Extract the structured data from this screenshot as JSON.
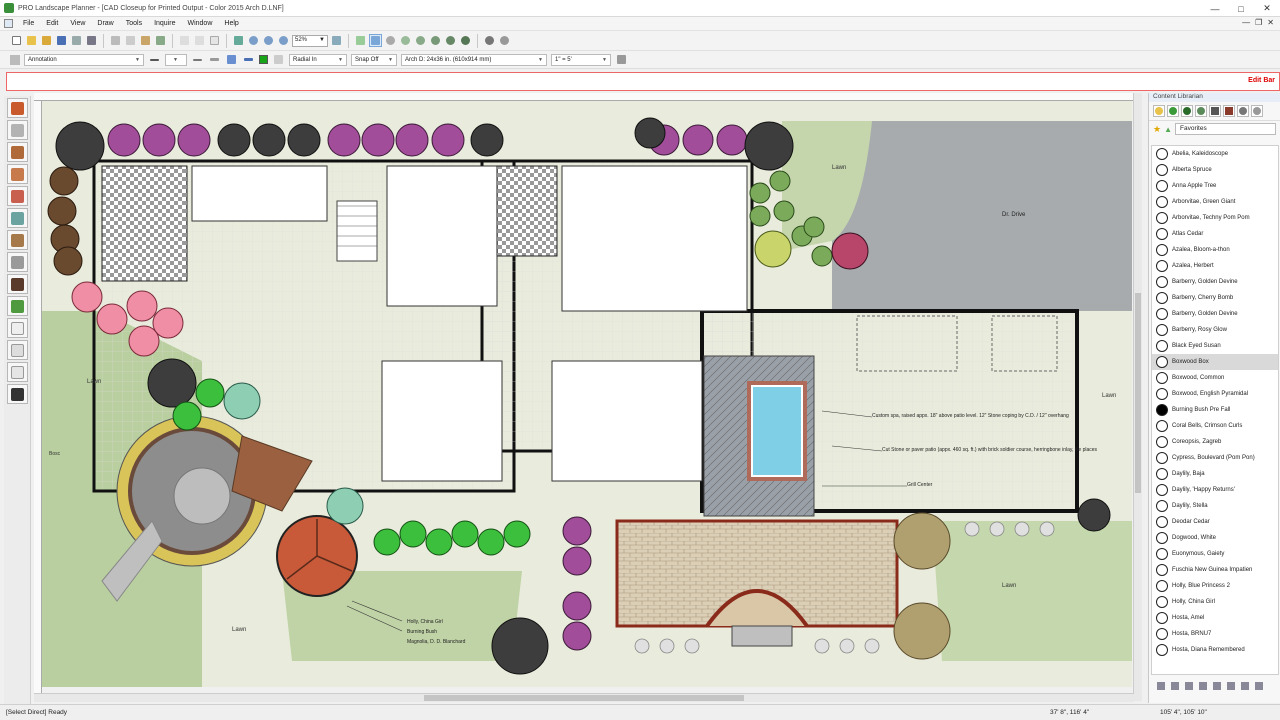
{
  "window": {
    "title": "PRO Landscape Planner - [CAD Closeup for Printed Output - Color 2015 Arch D.LNF]"
  },
  "menu": [
    "File",
    "Edit",
    "View",
    "Draw",
    "Tools",
    "Inquire",
    "Window",
    "Help"
  ],
  "toolbar": {
    "zoom": "52%"
  },
  "toolbar2": {
    "layer": "Annotation",
    "radial": "Radial In",
    "snap": "Snap Off",
    "sheet": "Arch D: 24x36 in. (610x914 mm)",
    "scale": "1\" = 5'"
  },
  "command_bar": {
    "mode": "Edit Bar"
  },
  "plan_labels": {
    "lawn": "Lawn",
    "drive": "Dr. Drive",
    "note_spa": "Custom spa, raised appx. 18\" above patio level. 12\" Stone coping by C.D. / 12\" overhang",
    "note_stone": "Cut Stone or paver patio (appx. 460 sq. ft.) with brick soldier course, herringbone inlay, tile places",
    "note_grill": "Grill Center",
    "holly": "Holly, China Girl",
    "burning_bush": "Burning Bush",
    "magnolia": "Magnolia, D. D. Blanchard",
    "bosc": "Bosc"
  },
  "content_librarian": {
    "title": "Content Librarian",
    "favorites": "Favorites",
    "items": [
      "Abelia, Kaleidoscope",
      "Alberta Spruce",
      "Anna Apple Tree",
      "Arborvitae, Green Giant",
      "Arborvitae, Techny Pom Pom",
      "Atlas Cedar",
      "Azalea, Bloom-a-thon",
      "Azalea, Herbert",
      "Barberry, Golden Devine",
      "Barberry, Cherry Bomb",
      "Barberry, Golden Devine",
      "Barberry, Rosy Glow",
      "Black Eyed Susan",
      "Boxwood Box",
      "Boxwood, Common",
      "Boxwood, English Pyramidal",
      "Burning Bush Pre Fall",
      "Coral Bells, Crimson Curls",
      "Coreopsis, Zagreb",
      "Cypress, Boulevard (Pom Pon)",
      "Daylily, Baja",
      "Daylily, 'Happy Returns'",
      "Daylily, Stella",
      "Deodar Cedar",
      "Dogwood, White",
      "Euonymous, Gaiety",
      "Fuschia New Guinea Impatien",
      "Holly, Blue Princess 2",
      "Holly, China Girl",
      "Hosta, Amel",
      "Hosta, BRNU7",
      "Hosta, Diana Remembered"
    ]
  },
  "status": {
    "left": "[Select Direct] Ready",
    "coord1": "37' 8\", 116' 4\"",
    "coord2": "105' 4\", 105' 10\""
  }
}
